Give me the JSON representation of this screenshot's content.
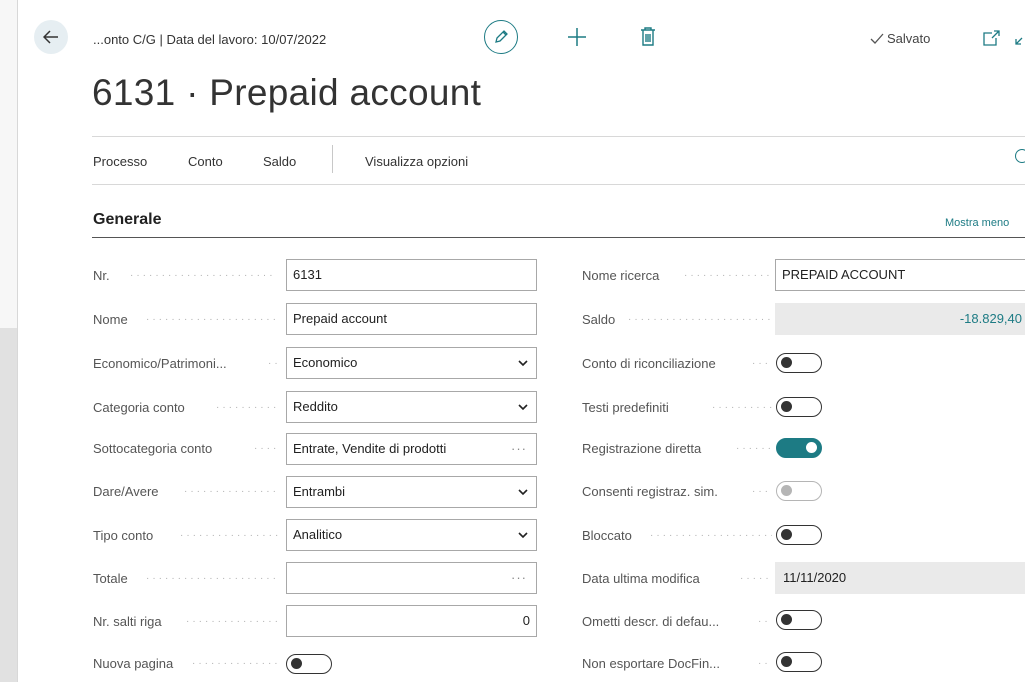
{
  "header": {
    "breadcrumb": "...onto C/G | Data del lavoro: 10/07/2022",
    "saved_status": "Salvato",
    "title": "6131 · Prepaid account"
  },
  "actions": [
    "Processo",
    "Conto",
    "Saldo",
    "Visualizza opzioni"
  ],
  "section": {
    "title": "Generale",
    "show_less": "Mostra meno"
  },
  "left_fields": {
    "nr": {
      "label": "Nr.",
      "value": "6131"
    },
    "nome": {
      "label": "Nome",
      "value": "Prepaid account"
    },
    "economico": {
      "label": "Economico/Patrimoni...",
      "value": "Economico"
    },
    "categoria": {
      "label": "Categoria conto",
      "value": "Reddito"
    },
    "sottocategoria": {
      "label": "Sottocategoria conto",
      "value": "Entrate, Vendite di prodotti"
    },
    "dare_avere": {
      "label": "Dare/Avere",
      "value": "Entrambi"
    },
    "tipo_conto": {
      "label": "Tipo conto",
      "value": "Analitico"
    },
    "totale": {
      "label": "Totale",
      "value": ""
    },
    "salti_riga": {
      "label": "Nr. salti riga",
      "value": "0"
    },
    "nuova_pagina": {
      "label": "Nuova pagina",
      "state": "off"
    }
  },
  "right_fields": {
    "nome_ricerca": {
      "label": "Nome ricerca",
      "value": "PREPAID ACCOUNT"
    },
    "saldo": {
      "label": "Saldo",
      "value": "-18.829,40"
    },
    "riconciliazione": {
      "label": "Conto di riconciliazione",
      "state": "off"
    },
    "testi": {
      "label": "Testi predefiniti",
      "state": "off"
    },
    "registrazione": {
      "label": "Registrazione diretta",
      "state": "on"
    },
    "consenti": {
      "label": "Consenti registraz. sim.",
      "state": "disabled"
    },
    "bloccato": {
      "label": "Bloccato",
      "state": "off"
    },
    "data_modifica": {
      "label": "Data ultima modifica",
      "value": "11/11/2020"
    },
    "ometti": {
      "label": "Ometti descr. di defau...",
      "state": "off"
    },
    "non_esportare": {
      "label": "Non esportare DocFin...",
      "state": "off"
    }
  },
  "colors": {
    "accent": "#1d7b84",
    "toggle_off": "#333333",
    "readonly_bg": "#eaeaea"
  },
  "icons": [
    "back-arrow-icon",
    "edit-pencil-icon",
    "plus-icon",
    "trash-icon",
    "checkmark-icon",
    "open-new-window-icon",
    "collapse-icon",
    "search-icon",
    "chevron-down-icon",
    "ellipsis-icon"
  ]
}
